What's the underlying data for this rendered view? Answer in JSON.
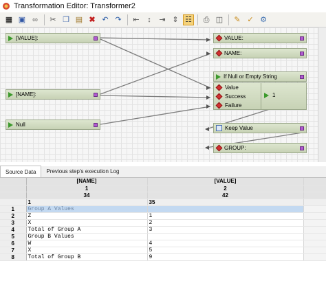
{
  "window": {
    "title": "Transformation Editor: Transformer2"
  },
  "toolbar": {
    "icons": [
      "layout-icon",
      "save-icon",
      "link-icon",
      "cut-icon",
      "copy-icon",
      "paste-icon",
      "delete-icon",
      "undo-icon",
      "redo-icon",
      "align-left-icon",
      "align-center-icon",
      "align-right-icon",
      "distribute-icon",
      "layout-tool-icon",
      "print-icon",
      "preview-icon",
      "settings-icon",
      "brush-icon",
      "export-icon"
    ]
  },
  "canvas": {
    "inputs": [
      {
        "label": "[VALUE]:"
      },
      {
        "label": "[NAME]:"
      },
      {
        "label": "Null"
      }
    ],
    "outputs": [
      {
        "label": "VALUE:"
      },
      {
        "label": "NAME:"
      },
      {
        "label": "Keep Value"
      },
      {
        "label": "GROUP:"
      }
    ],
    "function": {
      "title": "If Null or Empty String",
      "ports": [
        "Value",
        "Success",
        "Failure"
      ],
      "result": "1"
    }
  },
  "tabs": [
    {
      "label": "Source Data",
      "active": true
    },
    {
      "label": "Previous step's execution Log",
      "active": false
    }
  ],
  "table": {
    "columns": [
      "[NAME]",
      "[VALUE]"
    ],
    "column_numbers": [
      "1",
      "2"
    ],
    "column_widths": [
      "34",
      "42"
    ],
    "sub_header": [
      "1",
      "35"
    ],
    "rows": [
      {
        "n": "1",
        "name": "Group A Values",
        "value": ""
      },
      {
        "n": "2",
        "name": "Z",
        "value": "1"
      },
      {
        "n": "3",
        "name": "X",
        "value": "2"
      },
      {
        "n": "4",
        "name": "Total of Group A",
        "value": "3"
      },
      {
        "n": "5",
        "name": "Group B Values",
        "value": ""
      },
      {
        "n": "6",
        "name": "W",
        "value": "4"
      },
      {
        "n": "7",
        "name": "X",
        "value": "5"
      },
      {
        "n": "8",
        "name": "Total of Group B",
        "value": "9"
      }
    ]
  }
}
